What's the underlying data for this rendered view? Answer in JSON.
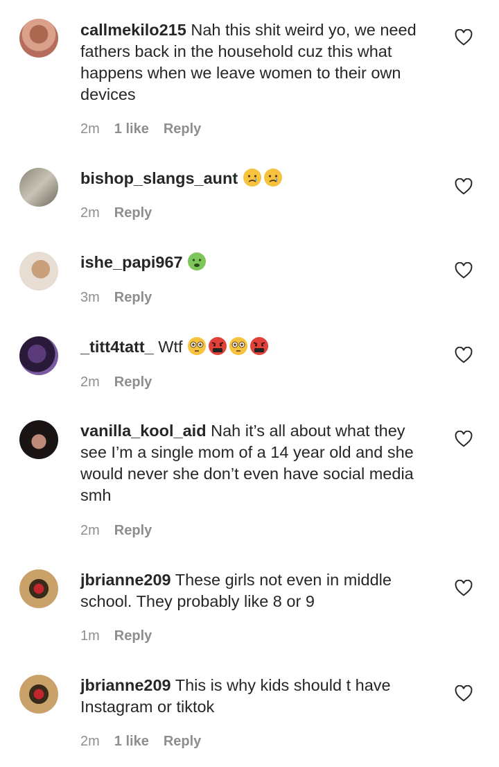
{
  "comments": [
    {
      "username": "callmekilo215",
      "text": "Nah this shit weird yo, we need fathers back in the household cuz this what happens when we leave women to their own devices",
      "time": "2m",
      "likes": "1 like",
      "reply": "Reply"
    },
    {
      "username": "bishop_slangs_aunt",
      "text": "",
      "emojis": [
        "crying-face",
        "crying-face"
      ],
      "time": "2m",
      "reply": "Reply"
    },
    {
      "username": "ishe_papi967",
      "text": "",
      "emojis": [
        "nauseated-face"
      ],
      "time": "3m",
      "reply": "Reply"
    },
    {
      "username": "_titt4tatt_",
      "text": "Wtf",
      "emojis": [
        "flushed-face",
        "cursing-face",
        "flushed-face",
        "cursing-face"
      ],
      "time": "2m",
      "reply": "Reply"
    },
    {
      "username": "vanilla_kool_aid",
      "text": "Nah it’s all about what they see I’m a single mom of a 14 year old and she would never she don’t even have social media smh",
      "time": "2m",
      "reply": "Reply"
    },
    {
      "username": "jbrianne209",
      "text": "These girls not even in middle school. They probably like 8 or 9",
      "time": "1m",
      "reply": "Reply"
    },
    {
      "username": "jbrianne209",
      "text": "This is why kids should t have Instagram or tiktok",
      "time": "2m",
      "likes": "1 like",
      "reply": "Reply"
    }
  ],
  "colors": {
    "text": "#262626",
    "meta": "#8e8e8e",
    "background": "#ffffff"
  }
}
